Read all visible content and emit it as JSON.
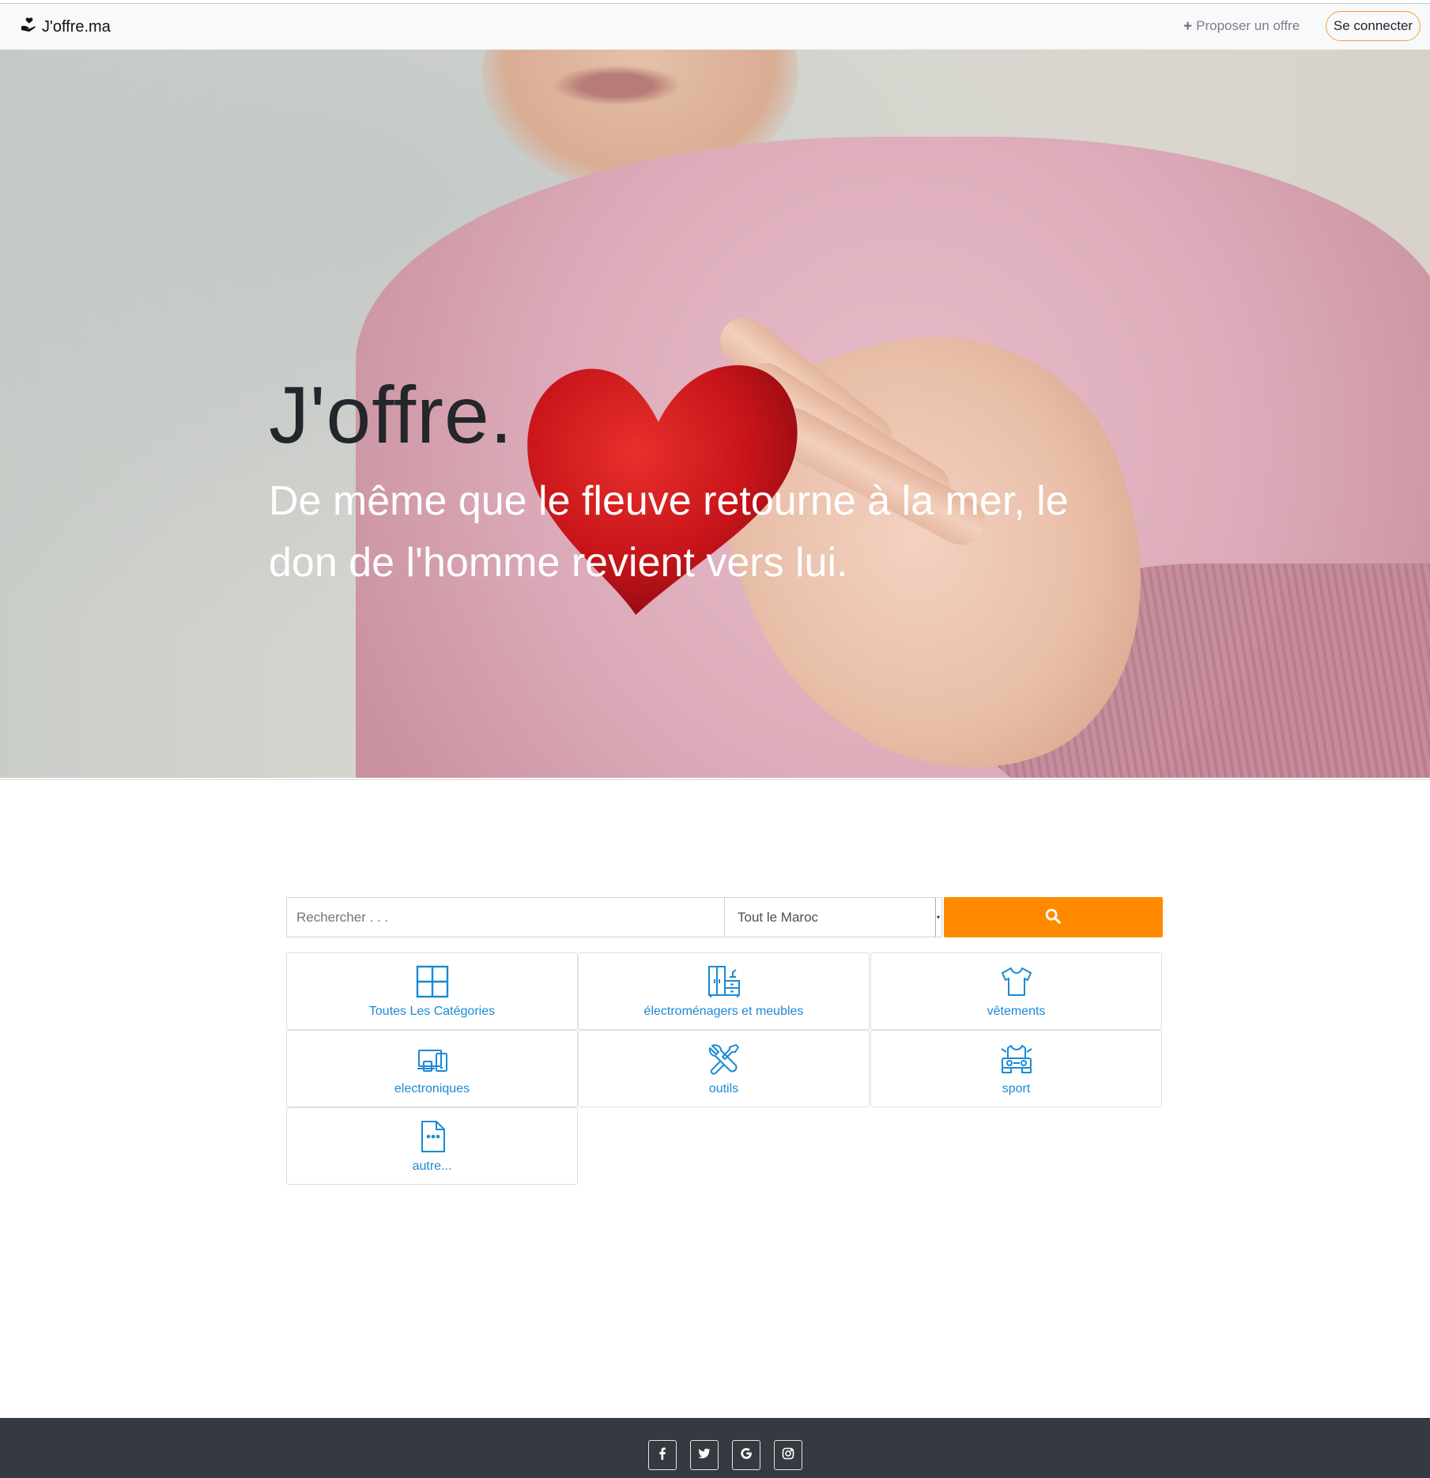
{
  "navbar": {
    "brand": "J'offre.ma",
    "propose_label": "Proposer un offre",
    "login_label": "Se connecter",
    "icons": {
      "brand": "hand-heart-icon",
      "propose": "plus-icon"
    }
  },
  "hero": {
    "title": "J'offre.",
    "subtitle": "De même que le fleuve retourne à la mer, le don de l'homme revient vers lui."
  },
  "search": {
    "placeholder": "Rechercher . . .",
    "region": "Tout le Maroc",
    "button_icon": "search-icon",
    "button_color": "#ff8a00"
  },
  "categories": [
    {
      "label": "Toutes Les Catégories",
      "icon": "grid-icon"
    },
    {
      "label": "électroménagers et meubles",
      "icon": "furniture-icon"
    },
    {
      "label": "vêtements",
      "icon": "tshirt-icon"
    },
    {
      "label": "electroniques",
      "icon": "devices-icon"
    },
    {
      "label": "outils",
      "icon": "tools-icon"
    },
    {
      "label": "sport",
      "icon": "sport-icon"
    },
    {
      "label": "autre...",
      "icon": "document-icon"
    }
  ],
  "footer": {
    "socials": [
      {
        "icon": "facebook-icon"
      },
      {
        "icon": "twitter-icon"
      },
      {
        "icon": "google-icon"
      },
      {
        "icon": "instagram-icon"
      }
    ]
  },
  "colors": {
    "accent": "#ff8a00",
    "link": "#1a8ad4",
    "footer_bg": "#343a40",
    "login_border": "#f0a23a"
  }
}
